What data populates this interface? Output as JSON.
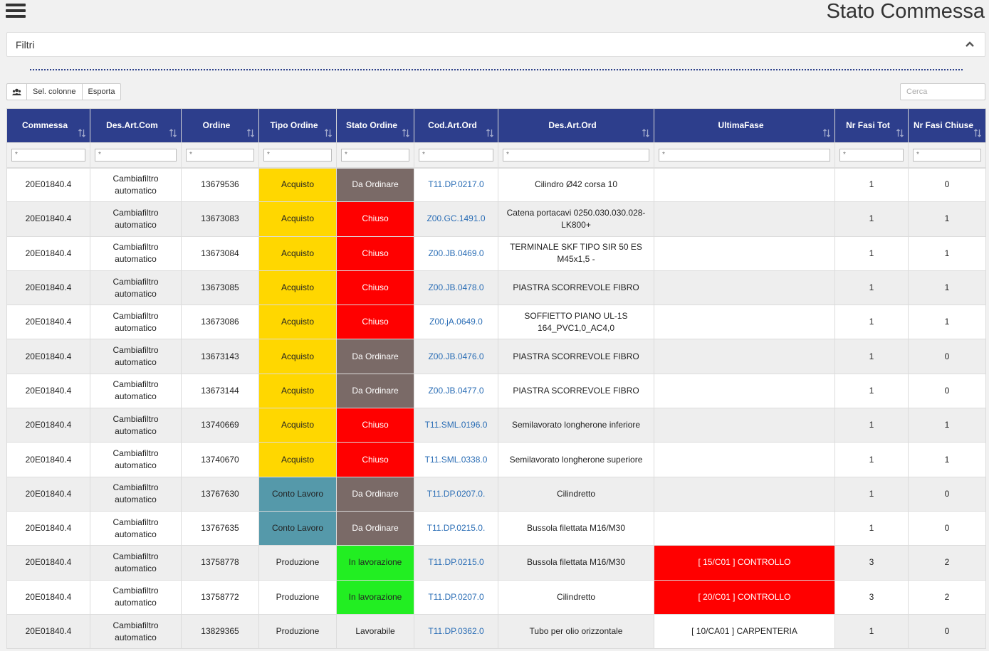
{
  "header": {
    "title": "Stato Commessa"
  },
  "filters": {
    "label": "Filtri"
  },
  "toolbar": {
    "sel_columns": "Sel. colonne",
    "export": "Esporta"
  },
  "search": {
    "placeholder": "Cerca"
  },
  "filter_placeholder": "*",
  "columns": [
    "Commessa",
    "Des.Art.Com",
    "Ordine",
    "Tipo Ordine",
    "Stato Ordine",
    "Cod.Art.Ord",
    "Des.Art.Ord",
    "UltimaFase",
    "Nr Fasi Tot",
    "Nr Fasi Chiuse"
  ],
  "colors": {
    "header_bg": "#2d3e8c",
    "yellow": "#ffd700",
    "teal": "#5599aa",
    "brown": "#7a6a67",
    "red": "#ff0000",
    "green": "#22ee22",
    "link": "#2a6db5"
  },
  "rows": [
    {
      "commessa": "20E01840.4",
      "des_art_com": "Cambiafiltro automatico",
      "ordine": "13679536",
      "tipo": "Acquisto",
      "tipo_color": "yellow",
      "stato": "Da Ordinare",
      "stato_color": "brown",
      "cod": "T11.DP.0217.0",
      "des_ord": "Cilindro Ø42 corsa 10",
      "fase": "",
      "fase_color": "",
      "tot": "1",
      "chiuse": "0"
    },
    {
      "commessa": "20E01840.4",
      "des_art_com": "Cambiafiltro automatico",
      "ordine": "13673083",
      "tipo": "Acquisto",
      "tipo_color": "yellow",
      "stato": "Chiuso",
      "stato_color": "red",
      "cod": "Z00.GC.1491.0",
      "des_ord": "Catena portacavi 0250.030.030.028-LK800+",
      "fase": "",
      "fase_color": "",
      "tot": "1",
      "chiuse": "1"
    },
    {
      "commessa": "20E01840.4",
      "des_art_com": "Cambiafiltro automatico",
      "ordine": "13673084",
      "tipo": "Acquisto",
      "tipo_color": "yellow",
      "stato": "Chiuso",
      "stato_color": "red",
      "cod": "Z00.JB.0469.0",
      "des_ord": "TERMINALE SKF TIPO SIR 50 ES M45x1,5 -",
      "fase": "",
      "fase_color": "",
      "tot": "1",
      "chiuse": "1"
    },
    {
      "commessa": "20E01840.4",
      "des_art_com": "Cambiafiltro automatico",
      "ordine": "13673085",
      "tipo": "Acquisto",
      "tipo_color": "yellow",
      "stato": "Chiuso",
      "stato_color": "red",
      "cod": "Z00.JB.0478.0",
      "des_ord": "PIASTRA SCORREVOLE FIBRO",
      "fase": "",
      "fase_color": "",
      "tot": "1",
      "chiuse": "1"
    },
    {
      "commessa": "20E01840.4",
      "des_art_com": "Cambiafiltro automatico",
      "ordine": "13673086",
      "tipo": "Acquisto",
      "tipo_color": "yellow",
      "stato": "Chiuso",
      "stato_color": "red",
      "cod": "Z00.jA.0649.0",
      "des_ord": "SOFFIETTO PIANO UL-1S 164_PVC1,0_AC4,0",
      "fase": "",
      "fase_color": "",
      "tot": "1",
      "chiuse": "1"
    },
    {
      "commessa": "20E01840.4",
      "des_art_com": "Cambiafiltro automatico",
      "ordine": "13673143",
      "tipo": "Acquisto",
      "tipo_color": "yellow",
      "stato": "Da Ordinare",
      "stato_color": "brown",
      "cod": "Z00.JB.0476.0",
      "des_ord": "PIASTRA SCORREVOLE FIBRO",
      "fase": "",
      "fase_color": "",
      "tot": "1",
      "chiuse": "0"
    },
    {
      "commessa": "20E01840.4",
      "des_art_com": "Cambiafiltro automatico",
      "ordine": "13673144",
      "tipo": "Acquisto",
      "tipo_color": "yellow",
      "stato": "Da Ordinare",
      "stato_color": "brown",
      "cod": "Z00.JB.0477.0",
      "des_ord": "PIASTRA SCORREVOLE FIBRO",
      "fase": "",
      "fase_color": "",
      "tot": "1",
      "chiuse": "0"
    },
    {
      "commessa": "20E01840.4",
      "des_art_com": "Cambiafiltro automatico",
      "ordine": "13740669",
      "tipo": "Acquisto",
      "tipo_color": "yellow",
      "stato": "Chiuso",
      "stato_color": "red",
      "cod": "T11.SML.0196.0",
      "des_ord": "Semilavorato longherone inferiore",
      "fase": "",
      "fase_color": "",
      "tot": "1",
      "chiuse": "1"
    },
    {
      "commessa": "20E01840.4",
      "des_art_com": "Cambiafiltro automatico",
      "ordine": "13740670",
      "tipo": "Acquisto",
      "tipo_color": "yellow",
      "stato": "Chiuso",
      "stato_color": "red",
      "cod": "T11.SML.0338.0",
      "des_ord": "Semilavorato longherone superiore",
      "fase": "",
      "fase_color": "",
      "tot": "1",
      "chiuse": "1"
    },
    {
      "commessa": "20E01840.4",
      "des_art_com": "Cambiafiltro automatico",
      "ordine": "13767630",
      "tipo": "Conto Lavoro",
      "tipo_color": "teal",
      "stato": "Da Ordinare",
      "stato_color": "brown",
      "cod": "T11.DP.0207.0.",
      "des_ord": "Cilindretto",
      "fase": "",
      "fase_color": "",
      "tot": "1",
      "chiuse": "0"
    },
    {
      "commessa": "20E01840.4",
      "des_art_com": "Cambiafiltro automatico",
      "ordine": "13767635",
      "tipo": "Conto Lavoro",
      "tipo_color": "teal",
      "stato": "Da Ordinare",
      "stato_color": "brown",
      "cod": "T11.DP.0215.0.",
      "des_ord": "Bussola filettata M16/M30",
      "fase": "",
      "fase_color": "",
      "tot": "1",
      "chiuse": "0"
    },
    {
      "commessa": "20E01840.4",
      "des_art_com": "Cambiafiltro automatico",
      "ordine": "13758778",
      "tipo": "Produzione",
      "tipo_color": "",
      "stato": "In lavorazione",
      "stato_color": "green",
      "cod": "T11.DP.0215.0",
      "des_ord": "Bussola filettata M16/M30",
      "fase": "[ 15/C01 ] CONTROLLO",
      "fase_color": "red",
      "tot": "3",
      "chiuse": "2"
    },
    {
      "commessa": "20E01840.4",
      "des_art_com": "Cambiafiltro automatico",
      "ordine": "13758772",
      "tipo": "Produzione",
      "tipo_color": "",
      "stato": "In lavorazione",
      "stato_color": "green",
      "cod": "T11.DP.0207.0",
      "des_ord": "Cilindretto",
      "fase": "[ 20/C01 ] CONTROLLO",
      "fase_color": "red",
      "tot": "3",
      "chiuse": "2"
    },
    {
      "commessa": "20E01840.4",
      "des_art_com": "Cambiafiltro automatico",
      "ordine": "13829365",
      "tipo": "Produzione",
      "tipo_color": "",
      "stato": "Lavorabile",
      "stato_color": "",
      "cod": "T11.DP.0362.0",
      "des_ord": "Tubo per olio orizzontale",
      "fase": "[ 10/CA01 ] CARPENTERIA",
      "fase_color": "white",
      "tot": "1",
      "chiuse": "0"
    }
  ]
}
